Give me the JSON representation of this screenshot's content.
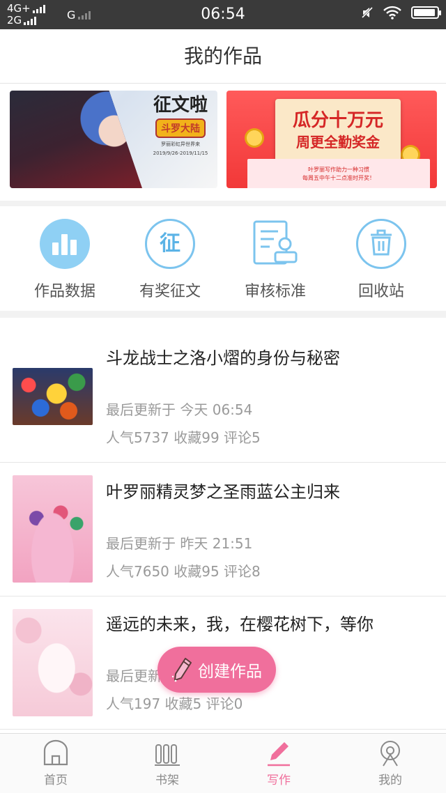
{
  "status_bar": {
    "network_1": "4G+",
    "network_2": "2G",
    "network_3": "G",
    "time": "06:54",
    "icons": [
      "mute-icon",
      "wifi-icon",
      "battery-icon"
    ],
    "battery_level": 0.95
  },
  "header": {
    "title": "我的作品"
  },
  "banners": [
    {
      "headline": "征文啦",
      "logo_text": "斗罗大陆",
      "tagline": "罗丽彩虹异世界来",
      "dates": "2019/9/26-2019/11/15"
    },
    {
      "headline": "瓜分十万元",
      "subheadline": "周更全勤奖金",
      "line1": "叶罗丽写作助力一种习惯",
      "line2": "每周五中午十二点准时开奖！"
    }
  ],
  "tools": [
    {
      "label": "作品数据",
      "icon": "bar-chart-icon"
    },
    {
      "label": "有奖征文",
      "icon": "contest-icon"
    },
    {
      "label": "审核标准",
      "icon": "review-standard-icon"
    },
    {
      "label": "回收站",
      "icon": "trash-icon"
    }
  ],
  "works": [
    {
      "title": "斗龙战士之洛小熠的身份与秘密",
      "updated": "最后更新于 今天 06:54",
      "stats": "人气5737 收藏99 评论5"
    },
    {
      "title": "叶罗丽精灵梦之圣雨蓝公主归来",
      "updated": "最后更新于 昨天 21:51",
      "stats": "人气7650 收藏95 评论8"
    },
    {
      "title": "遥远的未来，我，在樱花树下，等你",
      "updated": "最后更新于",
      "stats": "人气197 收藏5 评论0"
    }
  ],
  "fab": {
    "label": "创建作品",
    "icon": "pencil-icon"
  },
  "tabbar": [
    {
      "label": "首页",
      "icon": "home-icon",
      "active": false
    },
    {
      "label": "书架",
      "icon": "bookshelf-icon",
      "active": false
    },
    {
      "label": "写作",
      "icon": "write-icon",
      "active": true
    },
    {
      "label": "我的",
      "icon": "profile-icon",
      "active": false
    }
  ],
  "colors": {
    "accent": "#f06f9c",
    "tool_blue": "#7cc4ee",
    "status_bar": "#3a3a3a"
  }
}
